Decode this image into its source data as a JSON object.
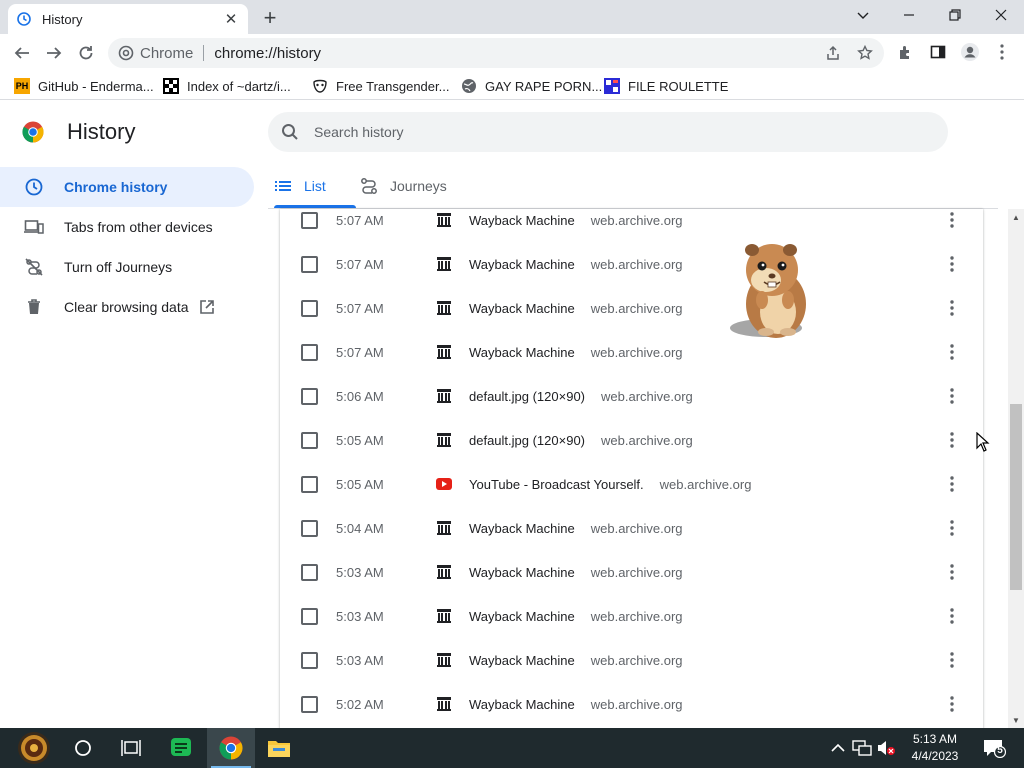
{
  "browser": {
    "tab_title": "History",
    "omnibox": {
      "site_chip": "Chrome",
      "url": "chrome://history"
    }
  },
  "bookmarks": [
    {
      "label": "GitHub - Enderma...",
      "icon": "ph-icon"
    },
    {
      "label": "Index of ~dartz/i...",
      "icon": "checker-icon"
    },
    {
      "label": "Free Transgender...",
      "icon": "mask-icon"
    },
    {
      "label": "GAY RAPE PORN...",
      "icon": "globe-icon"
    },
    {
      "label": "FILE ROULETTE",
      "icon": "file-roulette-icon"
    }
  ],
  "page": {
    "title": "History",
    "search_placeholder": "Search history"
  },
  "tabs": [
    {
      "label": "List",
      "active": true
    },
    {
      "label": "Journeys",
      "active": false
    }
  ],
  "sidebar": {
    "items": [
      {
        "label": "Chrome history",
        "icon": "clock-icon",
        "active": true
      },
      {
        "label": "Tabs from other devices",
        "icon": "devices-icon",
        "active": false
      },
      {
        "label": "Turn off Journeys",
        "icon": "journeys-off-icon",
        "active": false
      },
      {
        "label": "Clear browsing data",
        "icon": "trash-icon",
        "active": false
      }
    ]
  },
  "history": [
    {
      "time": "5:07 AM",
      "title": "Wayback Machine",
      "domain": "web.archive.org",
      "icon": "archive-icon"
    },
    {
      "time": "5:07 AM",
      "title": "Wayback Machine",
      "domain": "web.archive.org",
      "icon": "archive-icon"
    },
    {
      "time": "5:07 AM",
      "title": "Wayback Machine",
      "domain": "web.archive.org",
      "icon": "archive-icon"
    },
    {
      "time": "5:07 AM",
      "title": "Wayback Machine",
      "domain": "web.archive.org",
      "icon": "archive-icon"
    },
    {
      "time": "5:06 AM",
      "title": "default.jpg (120×90)",
      "domain": "web.archive.org",
      "icon": "archive-icon"
    },
    {
      "time": "5:05 AM",
      "title": "default.jpg (120×90)",
      "domain": "web.archive.org",
      "icon": "archive-icon"
    },
    {
      "time": "5:05 AM",
      "title": "YouTube - Broadcast Yourself.",
      "domain": "web.archive.org",
      "icon": "youtube-icon"
    },
    {
      "time": "5:04 AM",
      "title": "Wayback Machine",
      "domain": "web.archive.org",
      "icon": "archive-icon"
    },
    {
      "time": "5:03 AM",
      "title": "Wayback Machine",
      "domain": "web.archive.org",
      "icon": "archive-icon"
    },
    {
      "time": "5:03 AM",
      "title": "Wayback Machine",
      "domain": "web.archive.org",
      "icon": "archive-icon"
    },
    {
      "time": "5:03 AM",
      "title": "Wayback Machine",
      "domain": "web.archive.org",
      "icon": "archive-icon"
    },
    {
      "time": "5:02 AM",
      "title": "Wayback Machine",
      "domain": "web.archive.org",
      "icon": "archive-icon"
    }
  ],
  "taskbar": {
    "clock_time": "5:13 AM",
    "clock_date": "4/4/2023",
    "notification_count": "5"
  },
  "colors": {
    "accent": "#1a73e8",
    "sidebar_active_bg": "#e8f0fe",
    "taskbar_bg": "#1f2a2e"
  }
}
